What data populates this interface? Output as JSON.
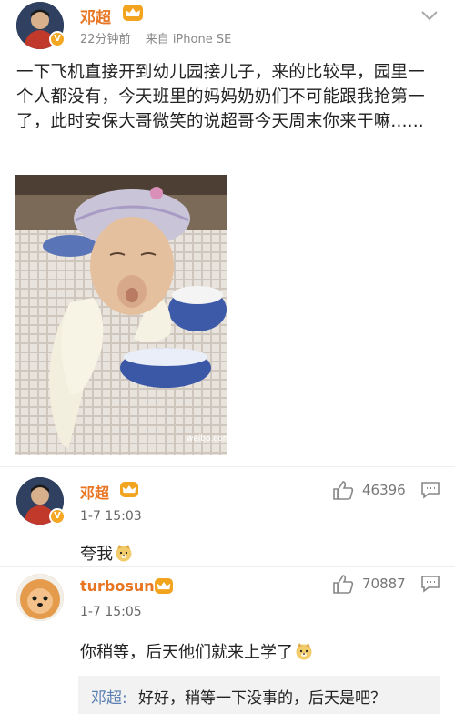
{
  "post": {
    "username": "邓超",
    "time": "22分钟前",
    "source": "来自 iPhone SE",
    "text": "一下飞机直接开到幼儿园接儿子，来的比较早，园里一个人都没有，今天班里的妈妈奶奶们不可能跟我抢第一了，此时安保大哥微笑的说超哥今天周末你来干嘛......",
    "image_watermark": "weibo.com/dengchao"
  },
  "comments": [
    {
      "username": "邓超",
      "time": "1-7 15:03",
      "text": "夸我",
      "emoji": "doge-icon",
      "likes": "46396"
    },
    {
      "username": "turbosun",
      "time": "1-7 15:05",
      "text": "你稍等，后天他们就来上学了",
      "emoji": "doge-icon",
      "likes": "70887"
    }
  ],
  "reply": {
    "author": "邓超:",
    "text": "好好，稍等一下没事的，后天是吧？"
  },
  "colors": {
    "username": "#e87521",
    "reply_author": "#5a7fb2",
    "badge": "#f5a623"
  }
}
